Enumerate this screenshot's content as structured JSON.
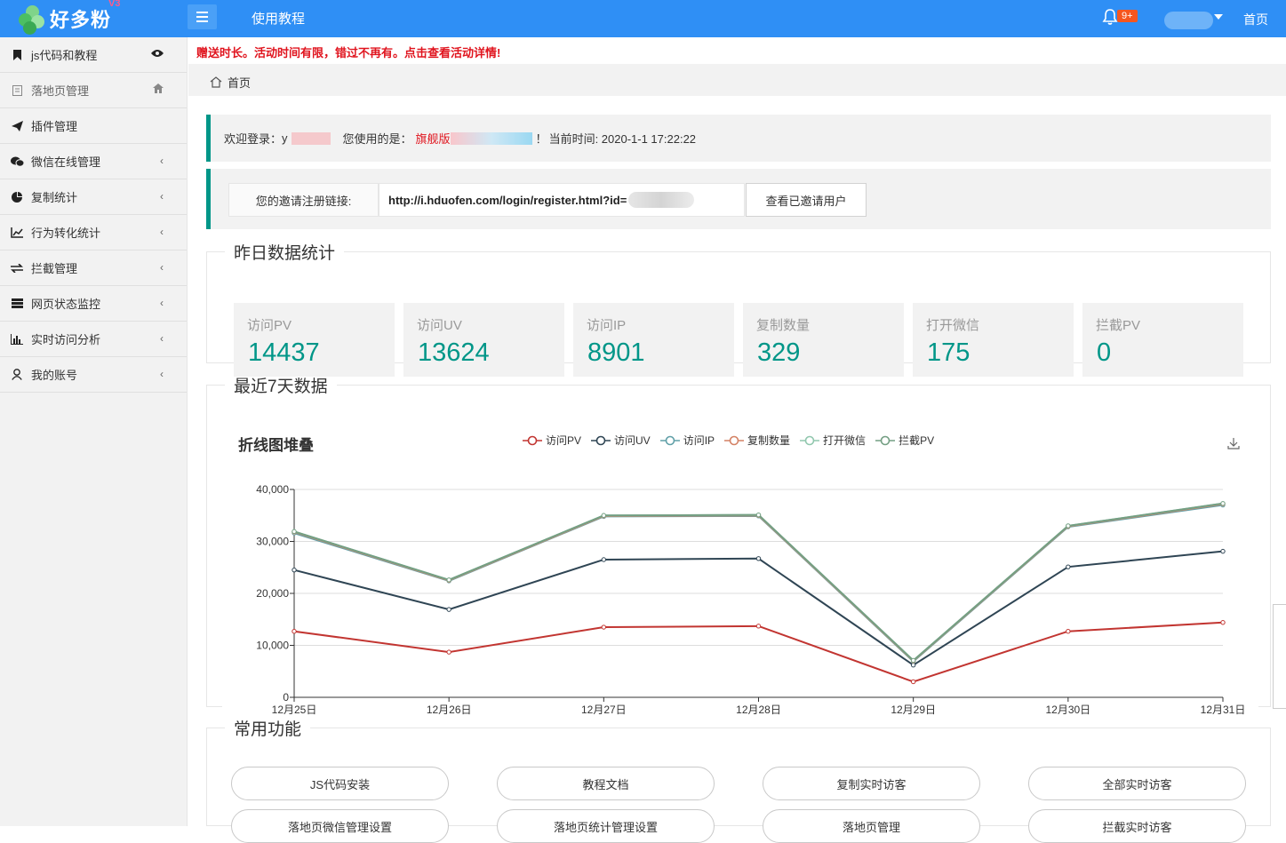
{
  "header": {
    "logo_text": "好多粉",
    "logo_badge": "V3",
    "page_title": "使用教程",
    "notification_count": "9+",
    "home_link": "首页"
  },
  "sidebar": {
    "items": [
      {
        "label": "js代码和教程",
        "icon": "bookmark-icon",
        "right": "eye-icon"
      },
      {
        "label": "落地页管理",
        "icon": "page-icon",
        "right": "home-icon"
      },
      {
        "label": "插件管理",
        "icon": "send-icon",
        "right": ""
      },
      {
        "label": "微信在线管理",
        "icon": "wechat-icon",
        "right": "chevron-left-icon"
      },
      {
        "label": "复制统计",
        "icon": "pie-icon",
        "right": "chevron-left-icon"
      },
      {
        "label": "行为转化统计",
        "icon": "line-chart-icon",
        "right": "chevron-left-icon"
      },
      {
        "label": "拦截管理",
        "icon": "exchange-icon",
        "right": "chevron-left-icon"
      },
      {
        "label": "网页状态监控",
        "icon": "server-icon",
        "right": "chevron-left-icon"
      },
      {
        "label": "实时访问分析",
        "icon": "bar-chart-icon",
        "right": "chevron-left-icon"
      },
      {
        "label": "我的账号",
        "icon": "user-icon",
        "right": "chevron-left-icon"
      }
    ]
  },
  "notice": "赠送时长。活动时间有限，错过不再有。点击查看活动详情!",
  "breadcrumb": "首页",
  "welcome": {
    "prefix": "欢迎登录：",
    "user": "y",
    "version_label": "您使用的是：",
    "version": "旗舰版",
    "exclaim": "！",
    "time_label": "当前时间: 2020-1-1 17:22:22"
  },
  "invite": {
    "label": "您的邀请注册链接:",
    "url": "http://i.hduofen.com/login/register.html?id=",
    "button": "查看已邀请用户"
  },
  "stats": {
    "title": "昨日数据统计",
    "items": [
      {
        "label": "访问PV",
        "value": "14437"
      },
      {
        "label": "访问UV",
        "value": "13624"
      },
      {
        "label": "访问IP",
        "value": "8901"
      },
      {
        "label": "复制数量",
        "value": "329"
      },
      {
        "label": "打开微信",
        "value": "175"
      },
      {
        "label": "拦截PV",
        "value": "0"
      }
    ]
  },
  "recent": {
    "title": "最近7天数据"
  },
  "chart_data": {
    "type": "line",
    "title": "折线图堆叠",
    "categories": [
      "12月25日",
      "12月26日",
      "12月27日",
      "12月28日",
      "12月29日",
      "12月30日",
      "12月31日"
    ],
    "ylim": [
      0,
      40000
    ],
    "yticks": [
      0,
      10000,
      20000,
      30000,
      40000
    ],
    "ytick_labels": [
      "0",
      "10,000",
      "20,000",
      "30,000",
      "40,000"
    ],
    "grid": true,
    "legend_position": "top",
    "series": [
      {
        "name": "访问PV",
        "color": "#c23531",
        "values": [
          12700,
          8700,
          13500,
          13700,
          3000,
          12700,
          14400
        ]
      },
      {
        "name": "访问UV",
        "color": "#2f4554",
        "values": [
          24500,
          16900,
          26500,
          26700,
          6200,
          25100,
          28100
        ]
      },
      {
        "name": "访问IP",
        "color": "#61a0a8",
        "values": [
          31600,
          22400,
          34800,
          34900,
          6900,
          32800,
          37000
        ]
      },
      {
        "name": "复制数量",
        "color": "#d48265",
        "values": [
          31800,
          22500,
          34900,
          35000,
          7000,
          32900,
          37200
        ]
      },
      {
        "name": "打开微信",
        "color": "#91c7ae",
        "values": [
          31900,
          22600,
          35000,
          35100,
          7100,
          33000,
          37300
        ]
      },
      {
        "name": "拦截PV",
        "color": "#749f83",
        "values": [
          31900,
          22600,
          35000,
          35100,
          7100,
          33000,
          37300
        ]
      }
    ]
  },
  "functions": {
    "title": "常用功能",
    "buttons": [
      "JS代码安装",
      "教程文档",
      "复制实时访客",
      "全部实时访客",
      "落地页微信管理设置",
      "落地页统计管理设置",
      "落地页管理",
      "拦截实时访客"
    ]
  }
}
